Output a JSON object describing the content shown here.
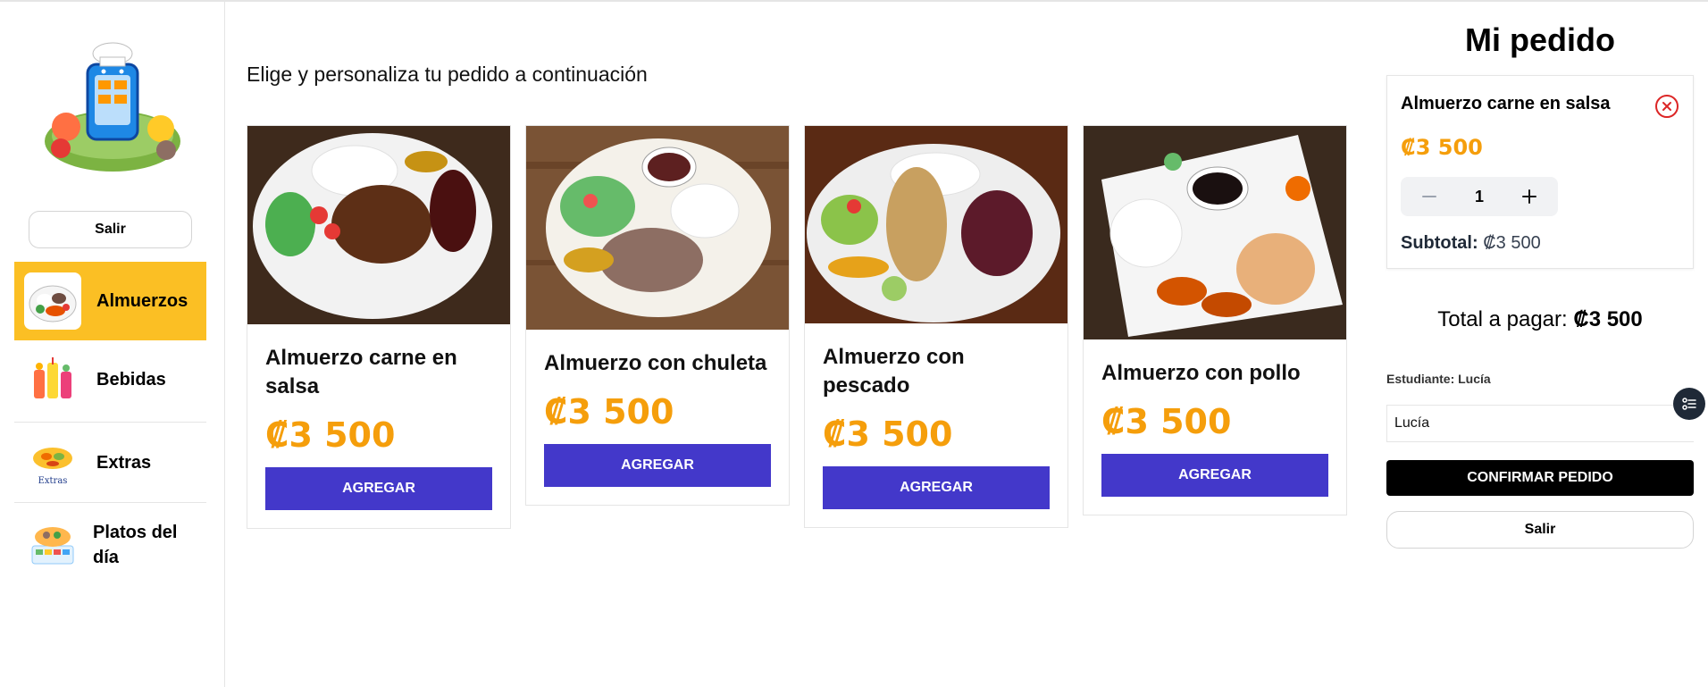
{
  "sidebar": {
    "exit_label": "Salir",
    "categories": [
      {
        "label": "Almuerzos",
        "active": true
      },
      {
        "label": "Bebidas",
        "active": false
      },
      {
        "label": "Extras",
        "active": false
      },
      {
        "label": "Platos del día",
        "active": false
      }
    ],
    "extras_thumb_caption": "Extras"
  },
  "main": {
    "intro": "Elige y personaliza tu pedido a continuación",
    "products": [
      {
        "title": "Almuerzo carne en salsa",
        "price": "₡3 500",
        "button": "AGREGAR"
      },
      {
        "title": "Almuerzo con chuleta",
        "price": "₡3 500",
        "button": "AGREGAR"
      },
      {
        "title": "Almuerzo con pescado",
        "price": "₡3 500",
        "button": "AGREGAR"
      },
      {
        "title": "Almuerzo con pollo",
        "price": "₡3 500",
        "button": "AGREGAR"
      }
    ]
  },
  "order": {
    "title": "Mi pedido",
    "item": {
      "name": "Almuerzo carne en salsa",
      "price": "₡3 500",
      "quantity": "1",
      "subtotal_label": "Subtotal:",
      "subtotal_value": "₡3 500"
    },
    "total_label": "Total a pagar:",
    "total_value": "₡3 500",
    "student_label": "Estudiante: Lucía",
    "student_value": "Lucía",
    "confirm_label": "CONFIRMAR PEDIDO",
    "exit_label": "Salir"
  },
  "colors": {
    "accent_yellow": "#fbbf24",
    "price_orange": "#f59e0b",
    "button_indigo": "#4338ca",
    "remove_red": "#dc2626"
  }
}
